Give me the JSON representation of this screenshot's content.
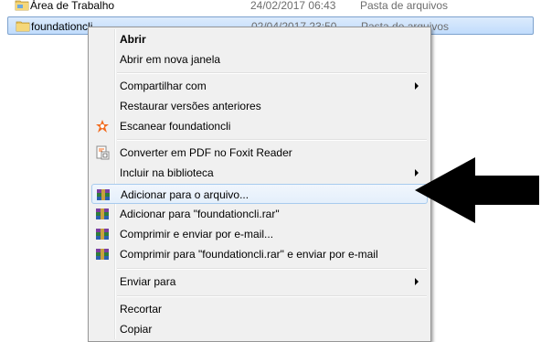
{
  "files": [
    {
      "name": "Área de Trabalho",
      "date": "24/02/2017 06:43",
      "type": "Pasta de arquivos",
      "selected": false
    },
    {
      "name": "foundationcli",
      "date": "02/04/2017 23:50",
      "type": "Pasta de arquivos",
      "selected": true
    }
  ],
  "menu": {
    "open": "Abrir",
    "open_new_window": "Abrir em nova janela",
    "share_with": "Compartilhar com",
    "restore_versions": "Restaurar versões anteriores",
    "scan": "Escanear foundationcli",
    "convert_pdf": "Converter em PDF no Foxit Reader",
    "include_library": "Incluir na biblioteca",
    "add_to_archive": "Adicionar para o arquivo...",
    "add_to_rar": "Adicionar para \"foundationcli.rar\"",
    "compress_email": "Comprimir e enviar por e-mail...",
    "compress_rar_email": "Comprimir para \"foundationcli.rar\" e enviar por e-mail",
    "send_to": "Enviar para",
    "cut": "Recortar",
    "copy": "Copiar"
  },
  "icons": {
    "folder": "folder-icon",
    "avast": "avast-icon",
    "foxit": "foxit-pdf-icon",
    "winrar": "winrar-icon",
    "submenu": "chevron-right-icon",
    "pointer": "big-arrow-icon"
  },
  "colors": {
    "selection_bg": "#cce4fc",
    "selection_border": "#7da2ce",
    "menu_bg": "#f0f0f0",
    "avast_orange": "#f26b1d"
  }
}
